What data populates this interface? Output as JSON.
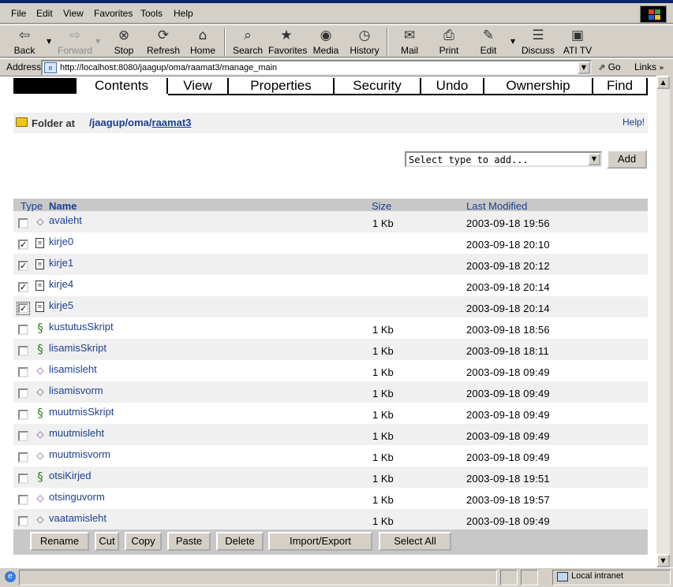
{
  "menubar": {
    "items": [
      "File",
      "Edit",
      "View",
      "Favorites",
      "Tools",
      "Help"
    ]
  },
  "toolbar": {
    "buttons": [
      {
        "label": "Back",
        "icon": "back-arrow-icon"
      },
      {
        "label": "Forward",
        "icon": "forward-arrow-icon",
        "disabled": true
      },
      {
        "label": "Stop",
        "icon": "stop-icon"
      },
      {
        "label": "Refresh",
        "icon": "refresh-icon"
      },
      {
        "label": "Home",
        "icon": "home-icon"
      },
      {
        "label": "Search",
        "icon": "search-icon"
      },
      {
        "label": "Favorites",
        "icon": "favorites-icon"
      },
      {
        "label": "Media",
        "icon": "media-icon"
      },
      {
        "label": "History",
        "icon": "history-icon"
      },
      {
        "label": "Mail",
        "icon": "mail-icon"
      },
      {
        "label": "Print",
        "icon": "print-icon"
      },
      {
        "label": "Edit",
        "icon": "edit-icon"
      },
      {
        "label": "Discuss",
        "icon": "discuss-icon"
      },
      {
        "label": "ATI TV",
        "icon": "tv-icon"
      }
    ]
  },
  "address": {
    "label": "Address",
    "url": "http://localhost:8080/jaagup/oma/raamat3/manage_main",
    "go_label": "Go",
    "links_label": "Links"
  },
  "tabs": [
    "Contents",
    "View",
    "Properties",
    "Security",
    "Undo",
    "Ownership",
    "Find"
  ],
  "folder": {
    "prefix": "Folder at",
    "path_sep": "/",
    "path": [
      "jaagup",
      "oma",
      "raamat3"
    ],
    "help_label": "Help!"
  },
  "add": {
    "select_value": "Select type to add...",
    "button_label": "Add"
  },
  "listing": {
    "columns": {
      "type": "Type",
      "name": "Name",
      "size": "Size",
      "modified": "Last Modified"
    },
    "rows": [
      {
        "name": "avaleht",
        "type": "dtml",
        "size": "1 Kb",
        "modified": "2003-09-18 19:56",
        "checked": false
      },
      {
        "name": "kirje0",
        "type": "doc",
        "size": "",
        "modified": "2003-09-18 20:10",
        "checked": true
      },
      {
        "name": "kirje1",
        "type": "doc",
        "size": "",
        "modified": "2003-09-18 20:12",
        "checked": true
      },
      {
        "name": "kirje4",
        "type": "doc",
        "size": "",
        "modified": "2003-09-18 20:14",
        "checked": true
      },
      {
        "name": "kirje5",
        "type": "doc",
        "size": "",
        "modified": "2003-09-18 20:14",
        "checked": true
      },
      {
        "name": "kustutusSkript",
        "type": "script",
        "size": "1 Kb",
        "modified": "2003-09-18 18:56",
        "checked": false
      },
      {
        "name": "lisamisSkript",
        "type": "script",
        "size": "1 Kb",
        "modified": "2003-09-18 18:11",
        "checked": false
      },
      {
        "name": "lisamisleht",
        "type": "dtml",
        "size": "1 Kb",
        "modified": "2003-09-18 09:49",
        "checked": false
      },
      {
        "name": "lisamisvorm",
        "type": "dtml",
        "size": "1 Kb",
        "modified": "2003-09-18 09:49",
        "checked": false
      },
      {
        "name": "muutmisSkript",
        "type": "script",
        "size": "1 Kb",
        "modified": "2003-09-18 09:49",
        "checked": false
      },
      {
        "name": "muutmisleht",
        "type": "dtml",
        "size": "1 Kb",
        "modified": "2003-09-18 09:49",
        "checked": false
      },
      {
        "name": "muutmisvorm",
        "type": "dtml",
        "size": "1 Kb",
        "modified": "2003-09-18 09:49",
        "checked": false
      },
      {
        "name": "otsiKirjed",
        "type": "script",
        "size": "1 Kb",
        "modified": "2003-09-18 19:51",
        "checked": false
      },
      {
        "name": "otsinguvorm",
        "type": "dtml",
        "size": "1 Kb",
        "modified": "2003-09-18 19:57",
        "checked": false
      },
      {
        "name": "vaatamisleht",
        "type": "dtml",
        "size": "1 Kb",
        "modified": "2003-09-18 09:49",
        "checked": false
      }
    ]
  },
  "actions": [
    "Rename",
    "Cut",
    "Copy",
    "Paste",
    "Delete",
    "Import/Export",
    "Select All"
  ],
  "status": {
    "zone": "Local intranet"
  }
}
